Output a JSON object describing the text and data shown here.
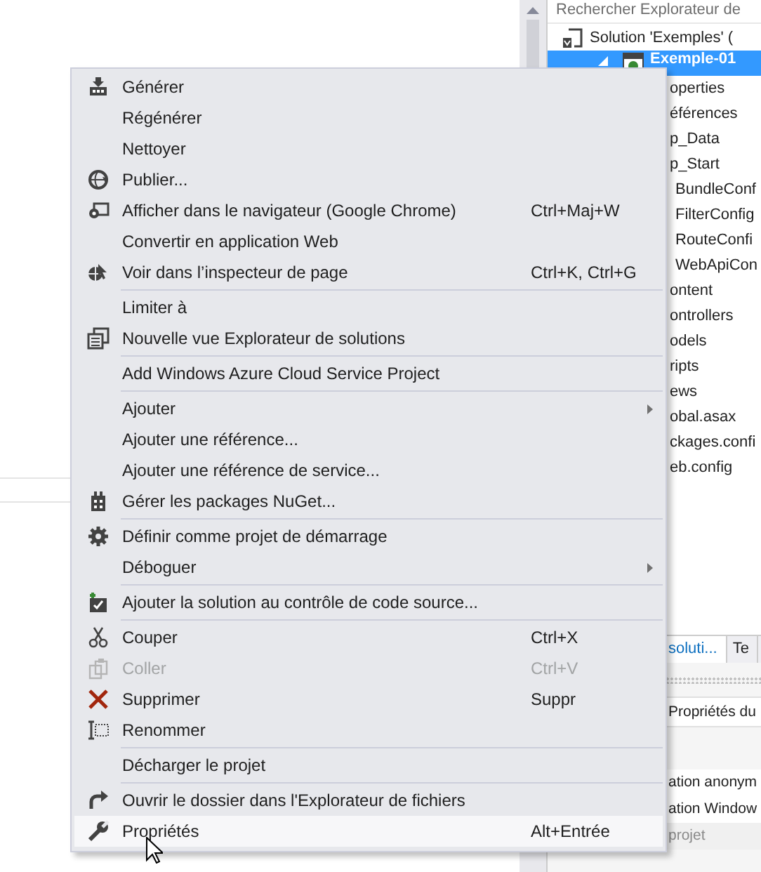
{
  "context_menu": {
    "groups": [
      [
        {
          "label": "Générer",
          "has_submenu": false,
          "disabled": false,
          "selected": false
        },
        {
          "label": "Régénérer",
          "has_submenu": false,
          "disabled": false,
          "selected": false
        },
        {
          "label": "Nettoyer",
          "has_submenu": false,
          "disabled": false,
          "selected": false
        },
        {
          "label": "Publier...",
          "has_submenu": false,
          "disabled": false,
          "selected": false
        },
        {
          "label": "Afficher dans le navigateur (Google Chrome)",
          "shortcut": "Ctrl+Maj+W",
          "has_submenu": false,
          "disabled": false,
          "selected": false
        },
        {
          "label": "Convertir en application Web",
          "has_submenu": false,
          "disabled": false,
          "selected": false
        },
        {
          "label": "Voir dans l’inspecteur de page",
          "shortcut": "Ctrl+K, Ctrl+G",
          "has_submenu": false,
          "disabled": false,
          "selected": false
        }
      ],
      [
        {
          "label": "Limiter à",
          "has_submenu": false,
          "disabled": false,
          "selected": false
        },
        {
          "label": "Nouvelle vue Explorateur de solutions",
          "has_submenu": false,
          "disabled": false,
          "selected": false
        }
      ],
      [
        {
          "label": "Add Windows Azure Cloud Service Project",
          "has_submenu": false,
          "disabled": false,
          "selected": false
        }
      ],
      [
        {
          "label": "Ajouter",
          "has_submenu": true,
          "disabled": false,
          "selected": false
        },
        {
          "label": "Ajouter une référence...",
          "has_submenu": false,
          "disabled": false,
          "selected": false
        },
        {
          "label": "Ajouter une référence de service...",
          "has_submenu": false,
          "disabled": false,
          "selected": false
        },
        {
          "label": "Gérer les packages NuGet...",
          "has_submenu": false,
          "disabled": false,
          "selected": false
        }
      ],
      [
        {
          "label": "Définir comme projet de démarrage",
          "has_submenu": false,
          "disabled": false,
          "selected": false
        },
        {
          "label": "Déboguer",
          "has_submenu": true,
          "disabled": false,
          "selected": false
        }
      ],
      [
        {
          "label": "Ajouter la solution au contrôle de code source...",
          "has_submenu": false,
          "disabled": false,
          "selected": false
        }
      ],
      [
        {
          "label": "Couper",
          "shortcut": "Ctrl+X",
          "has_submenu": false,
          "disabled": false,
          "selected": false
        },
        {
          "label": "Coller",
          "shortcut": "Ctrl+V",
          "has_submenu": false,
          "disabled": true,
          "selected": false
        },
        {
          "label": "Supprimer",
          "shortcut": "Suppr",
          "has_submenu": false,
          "disabled": false,
          "selected": false
        },
        {
          "label": "Renommer",
          "has_submenu": false,
          "disabled": false,
          "selected": false
        }
      ],
      [
        {
          "label": "Décharger le projet",
          "has_submenu": false,
          "disabled": false,
          "selected": false
        }
      ],
      [
        {
          "label": "Ouvrir le dossier dans l'Explorateur de fichiers",
          "has_submenu": false,
          "disabled": false,
          "selected": false
        },
        {
          "label": "Propriétés",
          "shortcut": "Alt+Entrée",
          "has_submenu": false,
          "disabled": false,
          "selected": true
        }
      ]
    ]
  },
  "solution_explorer": {
    "search": {
      "placeholder": "Rechercher Explorateur de"
    },
    "tree": [
      {
        "label": "Solution 'Exemples' (",
        "selected": false,
        "children": [
          {
            "label": "Exemple-01",
            "selected": true,
            "expanded": true,
            "children": [
              {
                "label": "operties",
                "selected": false
              },
              {
                "label": "éférences",
                "selected": false
              },
              {
                "label": "p_Data",
                "selected": false
              },
              {
                "label": "p_Start",
                "selected": false,
                "children": [
                  {
                    "label": "BundleConf",
                    "selected": false
                  },
                  {
                    "label": "FilterConfig",
                    "selected": false
                  },
                  {
                    "label": "RouteConfi",
                    "selected": false
                  },
                  {
                    "label": "WebApiCon",
                    "selected": false
                  }
                ]
              },
              {
                "label": "ontent",
                "selected": false
              },
              {
                "label": "ontrollers",
                "selected": false
              },
              {
                "label": "odels",
                "selected": false
              },
              {
                "label": "ripts",
                "selected": false
              },
              {
                "label": "ews",
                "selected": false
              },
              {
                "label": "obal.asax",
                "selected": false
              },
              {
                "label": "ckages.confi",
                "selected": false
              },
              {
                "label": "eb.config",
                "selected": false
              }
            ]
          }
        ]
      }
    ],
    "tabs": [
      {
        "label": "soluti...",
        "selected": true
      },
      {
        "label": "Te",
        "selected": false
      }
    ]
  },
  "properties": {
    "title": "Propriétés du",
    "rows": [
      {
        "kind": "property",
        "label": "ation anonym"
      },
      {
        "kind": "property",
        "label": "ation Window"
      },
      {
        "kind": "category",
        "label": "projet"
      }
    ]
  }
}
